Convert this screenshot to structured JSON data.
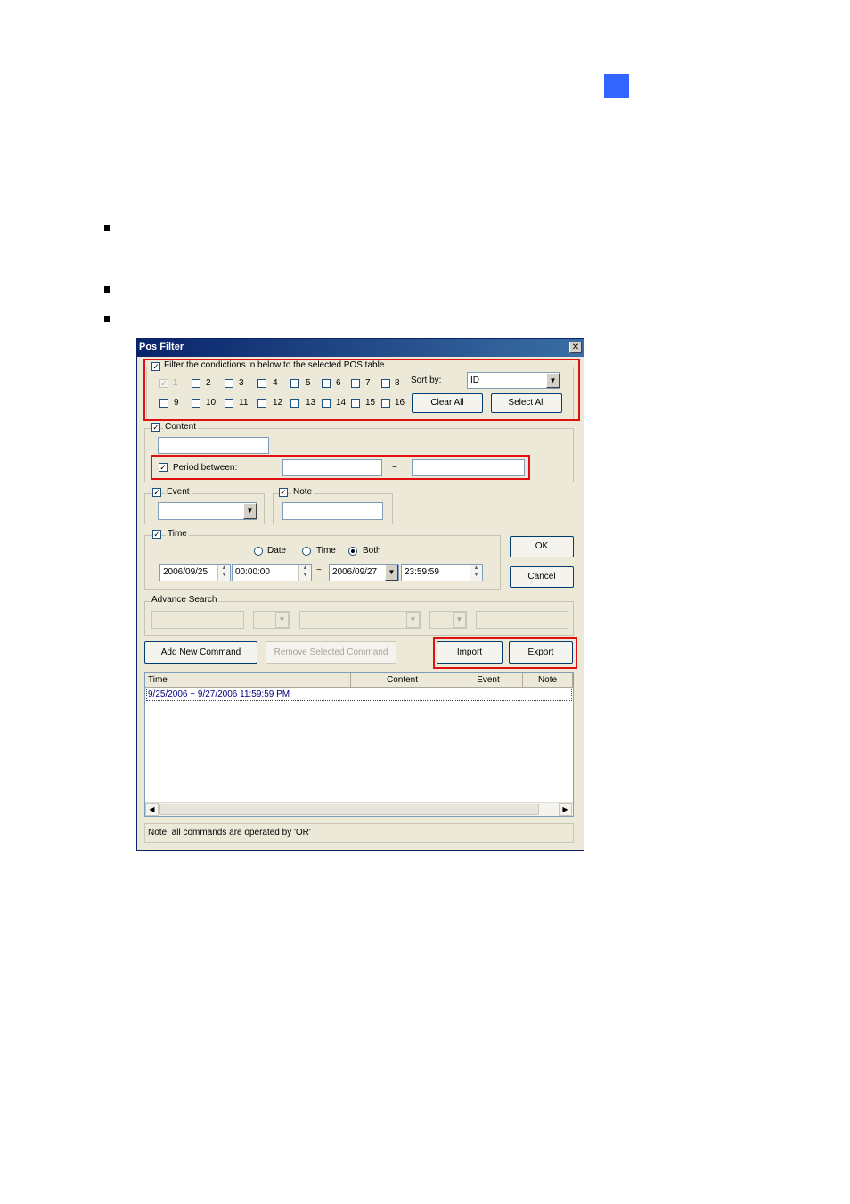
{
  "dialog": {
    "title": "Pos Filter",
    "close_glyph": "✕",
    "filter_pos": {
      "label": "Filter the condictions in below to the selected POS table",
      "checkboxes": [
        "1",
        "2",
        "3",
        "4",
        "5",
        "6",
        "7",
        "8",
        "9",
        "10",
        "11",
        "12",
        "13",
        "14",
        "15",
        "16"
      ],
      "sort_label": "Sort by:",
      "sort_value": "ID",
      "clear_all": "Clear All",
      "select_all": "Select All"
    },
    "content": {
      "label": "Content",
      "value": ""
    },
    "period": {
      "label": "Period between:",
      "separator": "~"
    },
    "event": {
      "label": "Event"
    },
    "note": {
      "label": "Note"
    },
    "time": {
      "label": "Time",
      "options": [
        "Date",
        "Time",
        "Both"
      ],
      "selected": "Both",
      "start_date": "2006/09/25",
      "start_time": "00:00:00",
      "separator": "~",
      "end_date": "2006/09/27",
      "end_time": "23:59:59"
    },
    "ok": "OK",
    "cancel": "Cancel",
    "advance_search": "Advance Search",
    "add_command": "Add New Command",
    "remove_command": "Remove Selected Command",
    "import": "Import",
    "export": "Export",
    "table": {
      "columns": [
        "Time",
        "Content",
        "Event",
        "Note"
      ],
      "rows": [
        {
          "time": "9/25/2006 ~ 9/27/2006 11:59:59 PM"
        }
      ]
    },
    "status_note": "Note: all commands are operated by 'OR'"
  }
}
